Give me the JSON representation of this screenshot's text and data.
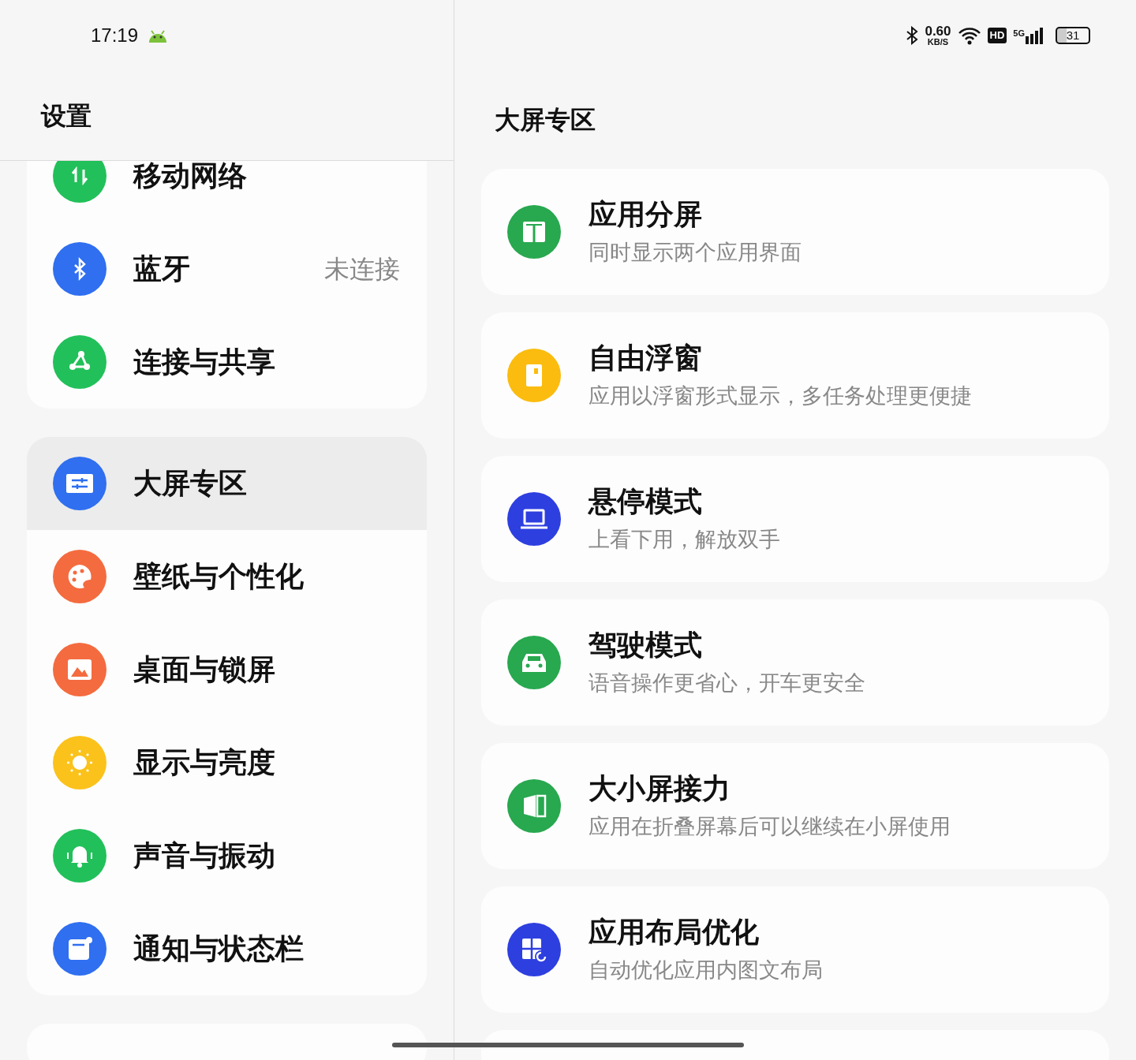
{
  "status_bar": {
    "time": "17:19",
    "net_speed": "0.60",
    "net_unit": "KB/S",
    "network": "5G",
    "hd": "HD",
    "battery": "31"
  },
  "left": {
    "title": "设置",
    "groups": [
      {
        "items": [
          {
            "label": "移动网络",
            "color": "#22c05a",
            "selected": false
          },
          {
            "label": "蓝牙",
            "value": "未连接",
            "color": "#2f6ff0",
            "selected": false
          },
          {
            "label": "连接与共享",
            "color": "#22c05a",
            "selected": false
          }
        ]
      },
      {
        "items": [
          {
            "label": "大屏专区",
            "color": "#2f6ff0",
            "selected": true
          },
          {
            "label": "壁纸与个性化",
            "color": "#f46b3f",
            "selected": false
          },
          {
            "label": "桌面与锁屏",
            "color": "#f46b3f",
            "selected": false
          },
          {
            "label": "显示与亮度",
            "color": "#fbc21b",
            "selected": false
          },
          {
            "label": "声音与振动",
            "color": "#22c05a",
            "selected": false
          },
          {
            "label": "通知与状态栏",
            "color": "#2f6ff0",
            "selected": false
          }
        ]
      }
    ]
  },
  "right": {
    "title": "大屏专区",
    "cards": [
      {
        "title": "应用分屏",
        "subtitle": "同时显示两个应用界面",
        "color": "#28a84f"
      },
      {
        "title": "自由浮窗",
        "subtitle": "应用以浮窗形式显示，多任务处理更便捷",
        "color": "#fbbc0f"
      },
      {
        "title": "悬停模式",
        "subtitle": "上看下用，解放双手",
        "color": "#2e3fe0"
      },
      {
        "title": "驾驶模式",
        "subtitle": "语音操作更省心，开车更安全",
        "color": "#28a84f"
      },
      {
        "title": "大小屏接力",
        "subtitle": "应用在折叠屏幕后可以继续在小屏使用",
        "color": "#28a84f"
      },
      {
        "title": "应用布局优化",
        "subtitle": "自动优化应用内图文布局",
        "color": "#2e3fe0"
      }
    ]
  }
}
